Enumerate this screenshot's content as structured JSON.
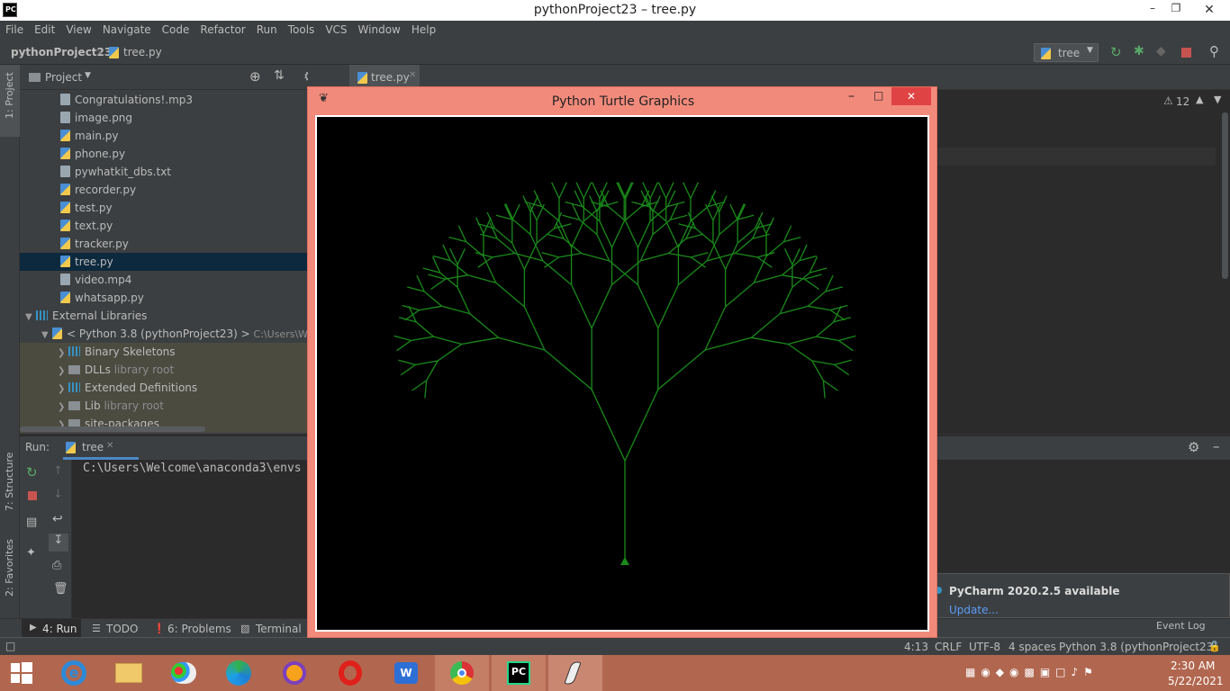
{
  "window": {
    "title": "pythonProject23 – tree.py"
  },
  "menu": [
    "File",
    "Edit",
    "View",
    "Navigate",
    "Code",
    "Refactor",
    "Run",
    "Tools",
    "VCS",
    "Window",
    "Help"
  ],
  "breadcrumb": {
    "project": "pythonProject23",
    "file": "tree.py"
  },
  "run_config": "tree",
  "left_strip": {
    "project": "1: Project",
    "structure": "7: Structure",
    "favorites": "2: Favorites"
  },
  "project_panel": {
    "title": "Project",
    "files": [
      "Congratulations!.mp3",
      "image.png",
      "main.py",
      "phone.py",
      "pywhatkit_dbs.txt",
      "recorder.py",
      "test.py",
      "text.py",
      "tracker.py",
      "tree.py",
      "video.mp4",
      "whatsapp.py"
    ],
    "selected": "tree.py",
    "external_libraries": "External Libraries",
    "python_sdk": "< Python 3.8 (pythonProject23) >",
    "python_sdk_path": "C:\\Users\\Welco",
    "libs": [
      {
        "name": "Binary Skeletons",
        "note": ""
      },
      {
        "name": "DLLs",
        "note": "library root"
      },
      {
        "name": "Extended Definitions",
        "note": ""
      },
      {
        "name": "Lib",
        "note": "library root"
      },
      {
        "name": "site-packages",
        "note": ""
      }
    ]
  },
  "editor": {
    "tab": "tree.py",
    "warnings": "12"
  },
  "run_panel": {
    "label": "Run:",
    "tab": "tree",
    "output": "C:\\Users\\Welcome\\anaconda3\\envs"
  },
  "turtle_window": {
    "title": "Python Turtle Graphics"
  },
  "bottom_tabs": [
    "4: Run",
    "TODO",
    "6: Problems",
    "Terminal"
  ],
  "event_log": "Event Log",
  "notification": {
    "title": "PyCharm 2020.2.5 available",
    "link": "Update..."
  },
  "status": {
    "position": "4:13",
    "line_sep": "CRLF",
    "encoding": "UTF-8",
    "indent": "4 spaces",
    "interpreter": "Python 3.8 (pythonProject23)"
  },
  "clock": {
    "time": "2:30 AM",
    "date": "5/22/2021"
  },
  "colors": {
    "tree": "#1a8a1a",
    "turtle_frame": "#f28a7b",
    "taskbar": "#b1674f"
  }
}
